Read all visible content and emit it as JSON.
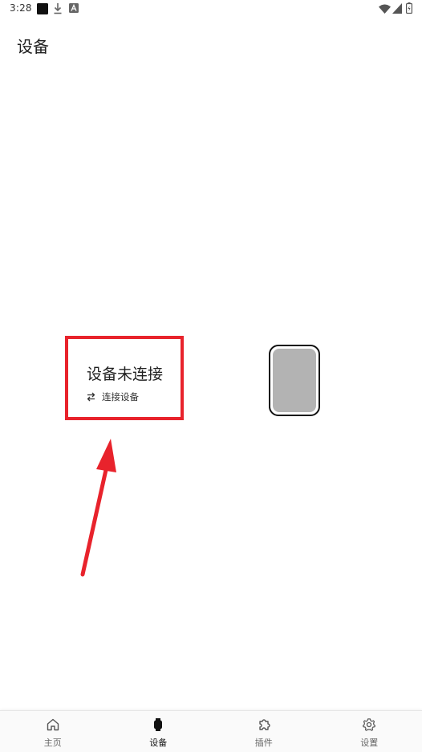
{
  "status_bar": {
    "time": "3:28",
    "left_icons": [
      "app-square-icon",
      "download-icon",
      "a-notification-icon"
    ],
    "right_icons": [
      "wifi-icon",
      "signal-icon",
      "battery-icon"
    ]
  },
  "header": {
    "title": "设备"
  },
  "device": {
    "status_text": "设备未连接",
    "connect_label": "连接设备",
    "connect_icon": "swap-arrows-icon",
    "watch_screen_color": "#b3b3b3"
  },
  "annotation": {
    "color": "#e8232c"
  },
  "bottom_nav": {
    "active_index": 1,
    "items": [
      {
        "label": "主页",
        "icon": "home-icon"
      },
      {
        "label": "设备",
        "icon": "watch-icon"
      },
      {
        "label": "插件",
        "icon": "puzzle-icon"
      },
      {
        "label": "设置",
        "icon": "gear-icon"
      }
    ]
  }
}
